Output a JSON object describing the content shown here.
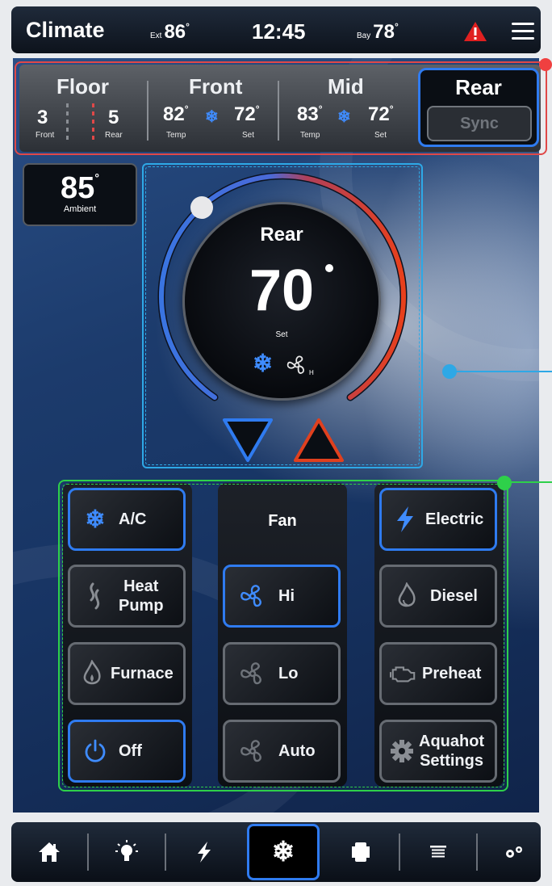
{
  "status_bar": {
    "title": "Climate",
    "exterior": {
      "label": "Ext",
      "value": "86",
      "deg": "°"
    },
    "clock": "12:45",
    "bay": {
      "label": "Bay",
      "value": "78",
      "deg": "°"
    },
    "alert_icon": "warning-icon",
    "menu_icon": "hamburger-menu-icon"
  },
  "zones": {
    "floor": {
      "label": "Floor",
      "front_value": "3",
      "front_label": "Front",
      "rear_value": "5",
      "rear_label": "Rear"
    },
    "front": {
      "label": "Front",
      "temp": "82",
      "temp_label": "Temp",
      "set": "72",
      "set_label": "Set",
      "mode_icon": "snowflake-icon"
    },
    "mid": {
      "label": "Mid",
      "temp": "83",
      "temp_label": "Temp",
      "set": "72",
      "set_label": "Set",
      "mode_icon": "snowflake-icon"
    },
    "rear": {
      "label": "Rear",
      "sync_label": "Sync"
    },
    "deg": "°"
  },
  "ambient": {
    "value": "85",
    "label": "Ambient",
    "deg": "°"
  },
  "dial": {
    "zone": "Rear",
    "set_temp": "70",
    "set_label": "Set",
    "fan_speed_label": "H",
    "mode_icon": "snowflake-icon",
    "fan_icon": "fan-icon",
    "down_icon": "triangle-down-icon",
    "up_icon": "triangle-up-icon"
  },
  "mode_column": {
    "buttons": [
      {
        "label": "A/C",
        "icon": "snowflake-icon",
        "active": true
      },
      {
        "label": "Heat Pump",
        "icon": "heat-pump-icon",
        "active": false
      },
      {
        "label": "Furnace",
        "icon": "flame-icon",
        "active": false
      },
      {
        "label": "Off",
        "icon": "power-icon",
        "active": true
      }
    ]
  },
  "fan_column": {
    "title": "Fan",
    "buttons": [
      {
        "label": "Hi",
        "icon": "fan-icon",
        "active": true
      },
      {
        "label": "Lo",
        "icon": "fan-icon",
        "active": false
      },
      {
        "label": "Auto",
        "icon": "fan-icon",
        "active": false
      }
    ]
  },
  "heat_column": {
    "buttons": [
      {
        "label": "Electric",
        "icon": "lightning-icon",
        "active": true
      },
      {
        "label": "Diesel",
        "icon": "fuel-drop-icon",
        "active": false
      },
      {
        "label": "Preheat",
        "icon": "engine-icon",
        "active": false
      },
      {
        "label": "Aquahot Settings",
        "icon": "gear-icon",
        "active": false
      }
    ]
  },
  "bottom_nav": [
    {
      "name": "home",
      "icon": "home-icon",
      "active": false
    },
    {
      "name": "lighting",
      "icon": "light-bulb-icon",
      "active": false
    },
    {
      "name": "power",
      "icon": "lightning-icon",
      "active": false
    },
    {
      "name": "climate",
      "icon": "snowflake-icon",
      "active": true
    },
    {
      "name": "slides",
      "icon": "slide-icon",
      "active": false
    },
    {
      "name": "shades",
      "icon": "shade-icon",
      "active": false
    },
    {
      "name": "settings",
      "icon": "gears-icon",
      "active": false
    }
  ],
  "colors": {
    "accent_blue": "#2f7bf0",
    "heat_red": "#e0401e",
    "alert_red": "#e02020",
    "outline_red": "#e04848",
    "outline_cyan": "#2ea8e6",
    "outline_green": "#2ed04a"
  }
}
